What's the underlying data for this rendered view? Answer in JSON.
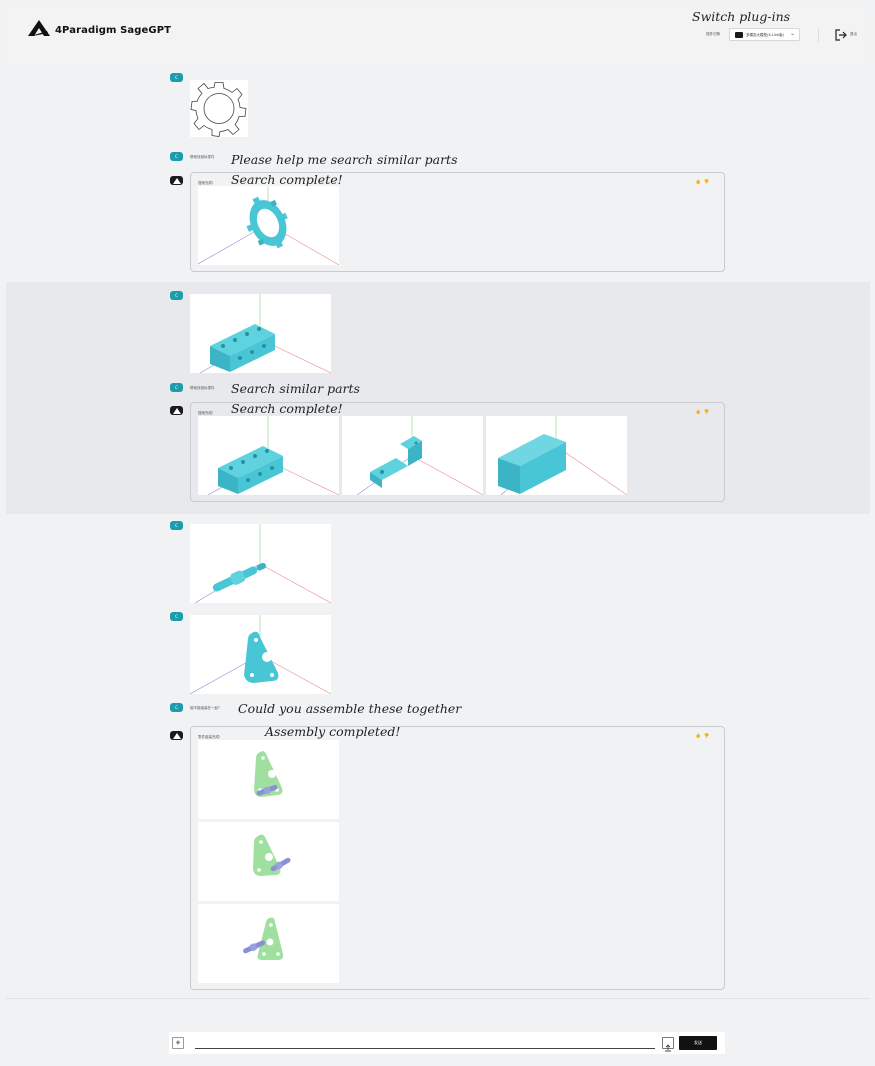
{
  "header": {
    "brand": "4Paradigm SageGPT",
    "switch_plugins_caption": "Switch plug-ins",
    "plugin_label": "插件切换",
    "plugin_selected": "多模态大模型(X-Link版)",
    "logout_label": "退出"
  },
  "conversation": {
    "user_avatar_label": "C",
    "turn1": {
      "user_query_small": "帮我找相似零件",
      "user_query_caption": "Please help me search similar parts",
      "reply_small": "搜索完成!",
      "reply_caption": "Search complete!"
    },
    "turn2": {
      "user_query_small": "帮我找相似零件",
      "user_query_caption": "Search similar parts",
      "reply_small": "搜索完成!",
      "reply_caption": "Search complete!"
    },
    "turn3": {
      "user_query_small": "能不能组装在一起?",
      "user_query_caption": "Could you assemble these together",
      "reply_small": "零件组装完成!",
      "reply_caption": "Assembly completed!"
    },
    "feedback": {
      "like": "👍",
      "dislike": "👎"
    }
  },
  "input": {
    "send_label": "发送",
    "plugin_icon_glyph": "◈",
    "upload_icon_glyph": "⇡"
  },
  "colors": {
    "part_cyan": "#49c6d6",
    "assembly_green": "#9fe0a1",
    "assembly_pin": "#8a8fd6",
    "avatar_user": "#1c9dab",
    "avatar_ai": "#1b1b1b"
  }
}
